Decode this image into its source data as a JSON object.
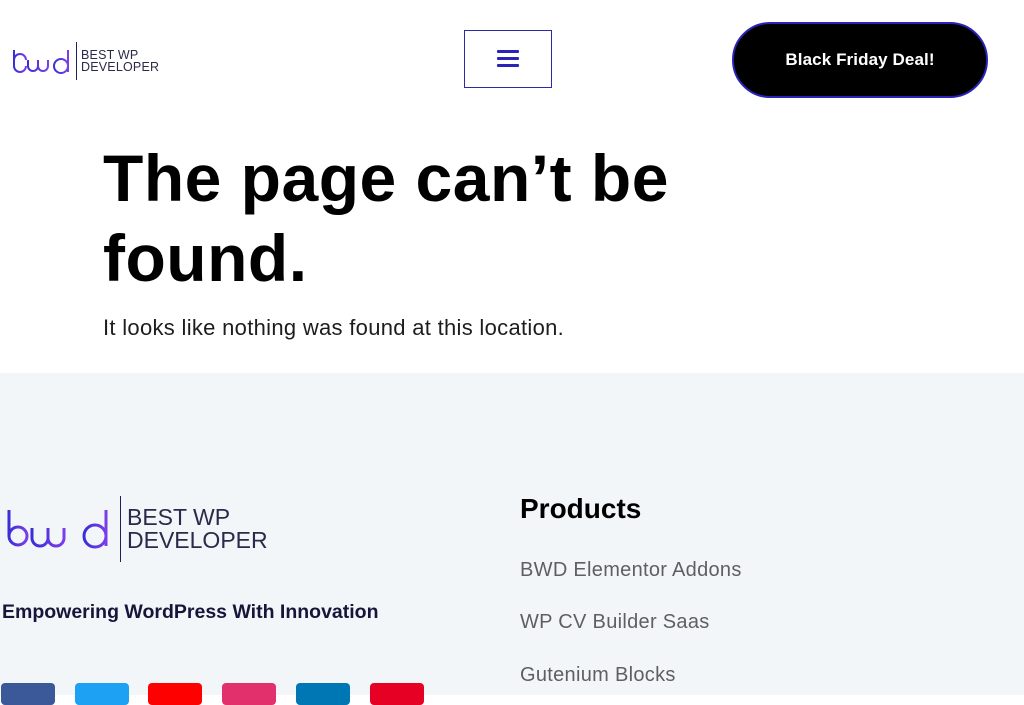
{
  "header": {
    "logo": {
      "text_line1": "BEST WP",
      "text_line2": "DEVELOPER",
      "icon": "bwd-logo-mark"
    },
    "menu_icon": "hamburger-menu-icon",
    "cta_label": "Black Friday Deal!"
  },
  "main": {
    "title": "The page can’t be found.",
    "message": "It looks like nothing was found at this location."
  },
  "footer": {
    "logo": {
      "text_line1": "BEST WP",
      "text_line2": "DEVELOPER"
    },
    "tagline": "Empowering WordPress With Innovation",
    "products": {
      "heading": "Products",
      "items": [
        "BWD Elementor Addons",
        "WP CV Builder Saas",
        "Gutenium Blocks"
      ]
    },
    "social": [
      {
        "icon": "facebook-icon",
        "color": "#3b5998"
      },
      {
        "icon": "twitter-icon",
        "color": "#1da1f2"
      },
      {
        "icon": "youtube-icon",
        "color": "#ff0000"
      },
      {
        "icon": "instagram-icon",
        "color": "#e1306c"
      },
      {
        "icon": "linkedin-icon",
        "color": "#0077b5"
      },
      {
        "icon": "pinterest-icon",
        "color": "#e60023"
      }
    ]
  },
  "colors": {
    "brand_purple": "#2b23b8",
    "cta_background": "#000000",
    "footer_background": "#f3f6f9"
  }
}
